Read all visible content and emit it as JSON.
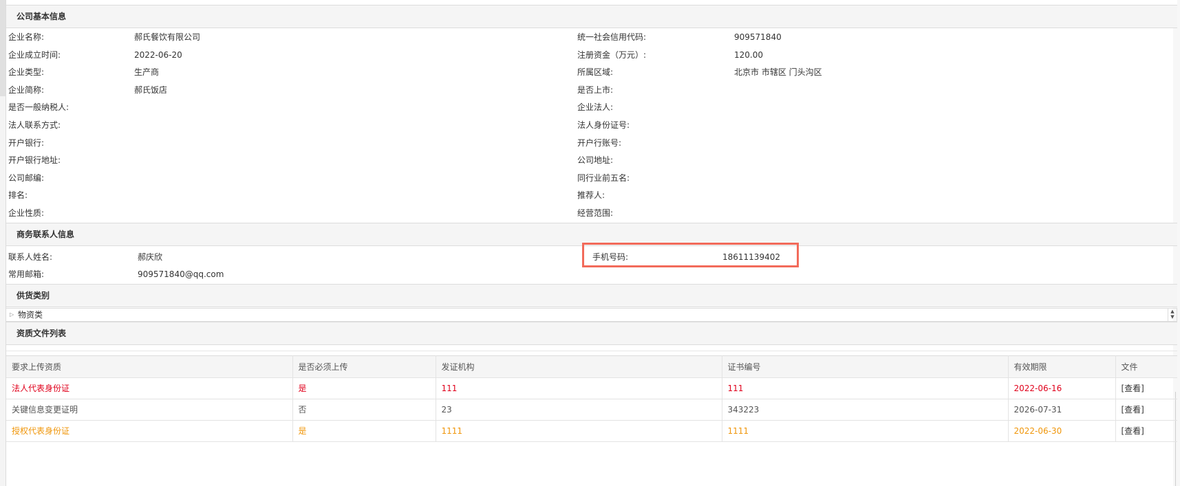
{
  "company_section": {
    "title": "公司基本信息",
    "rows": [
      {
        "label1": "企业名称:",
        "value1": "郝氏餐饮有限公司",
        "label2": "统一社会信用代码:",
        "value2": "909571840"
      },
      {
        "label1": "企业成立时间:",
        "value1": "2022-06-20",
        "label2": "注册资金（万元）:",
        "value2": "120.00"
      },
      {
        "label1": "企业类型:",
        "value1": "生产商",
        "label2": "所属区域:",
        "value2": "北京市 市辖区 门头沟区"
      },
      {
        "label1": "企业简称:",
        "value1": "郝氏饭店",
        "label2": "是否上市:",
        "value2": ""
      },
      {
        "label1": "是否一般纳税人:",
        "value1": "",
        "label2": "企业法人:",
        "value2": ""
      },
      {
        "label1": "法人联系方式:",
        "value1": "",
        "label2": "法人身份证号:",
        "value2": ""
      },
      {
        "label1": "开户银行:",
        "value1": "",
        "label2": "开户行账号:",
        "value2": ""
      },
      {
        "label1": "开户银行地址:",
        "value1": "",
        "label2": "公司地址:",
        "value2": ""
      },
      {
        "label1": "公司邮编:",
        "value1": "",
        "label2": "同行业前五名:",
        "value2": ""
      },
      {
        "label1": "排名:",
        "value1": "",
        "label2": "推荐人:",
        "value2": ""
      },
      {
        "label1": "企业性质:",
        "value1": "",
        "label2": "经营范围:",
        "value2": ""
      }
    ]
  },
  "contact_section": {
    "title": "商务联系人信息",
    "name_label": "联系人姓名:",
    "name_value": "郝庆欣",
    "phone_label": "手机号码:",
    "phone_value": "18611139402",
    "email_label": "常用邮箱:",
    "email_value": "909571840@qq.com"
  },
  "supply_section": {
    "title": "供货类别",
    "tree_item": "物资类"
  },
  "files_section": {
    "title": "资质文件列表",
    "columns": [
      "要求上传资质",
      "是否必须上传",
      "发证机构",
      "证书编号",
      "有效期限",
      "文件"
    ],
    "rows": [
      {
        "name": "法人代表身份证",
        "required": "是",
        "issuer": "111",
        "cert_no": "111",
        "expiry": "2022-06-16",
        "file": "[查看]",
        "color": "red"
      },
      {
        "name": "关键信息变更证明",
        "required": "否",
        "issuer": "23",
        "cert_no": "343223",
        "expiry": "2026-07-31",
        "file": "[查看]",
        "color": "gray"
      },
      {
        "name": "授权代表身份证",
        "required": "是",
        "issuer": "1111",
        "cert_no": "1111",
        "expiry": "2022-06-30",
        "file": "[查看]",
        "color": "orange"
      }
    ]
  },
  "colors": {
    "highlight": "#f26a5a",
    "expired_red": "#e0001b",
    "warning_orange": "#f0960a"
  }
}
